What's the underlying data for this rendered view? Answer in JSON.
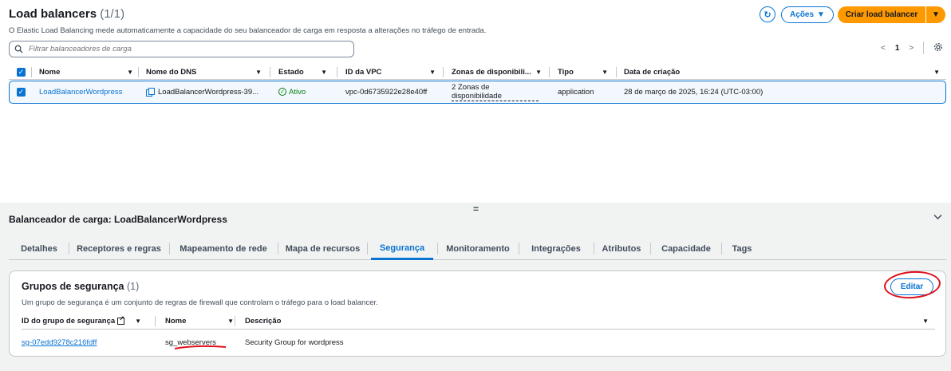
{
  "header": {
    "title": "Load balancers",
    "count": "(1/1)",
    "subtitle": "O Elastic Load Balancing mede automaticamente a capacidade do seu balanceador de carga em resposta a alterações no tráfego de entrada.",
    "actions_label": "Ações",
    "create_label": "Criar load balancer"
  },
  "search": {
    "placeholder": "Filtrar balanceadores de carga"
  },
  "pagination": {
    "page": "1"
  },
  "table": {
    "columns": [
      "Nome",
      "Nome do DNS",
      "Estado",
      "ID da VPC",
      "Zonas de disponibili...",
      "Tipo",
      "Data de criação"
    ],
    "rows": [
      {
        "name": "LoadBalancerWordpress",
        "dns": "LoadBalancerWordpress-39...",
        "state": "Ativo",
        "vpc": "vpc-0d6735922e28e40ff",
        "zones_line1": "2 Zonas de",
        "zones_line2": "disponibilidade",
        "type": "application",
        "created": "28 de março de 2025, 16:24 (UTC-03:00)"
      }
    ]
  },
  "detail": {
    "title": "Balanceador de carga: LoadBalancerWordpress",
    "tabs": [
      "Detalhes",
      "Receptores e regras",
      "Mapeamento de rede",
      "Mapa de recursos",
      "Segurança",
      "Monitoramento",
      "Integrações",
      "Atributos",
      "Capacidade",
      "Tags"
    ],
    "active_tab": "Segurança"
  },
  "security_groups": {
    "title": "Grupos de segurança",
    "count": "(1)",
    "description": "Um grupo de segurança é um conjunto de regras de firewall que controlam o tráfego para o load balancer.",
    "edit_label": "Editar",
    "columns": [
      "ID do grupo de segurança",
      "Nome",
      "Descrição"
    ],
    "rows": [
      {
        "id": "sg-07edd9278c216fdff",
        "name": "sg_webservers",
        "description": "Security Group for wordpress"
      }
    ]
  },
  "colors": {
    "accent": "#0972d3",
    "primary_button": "#ff9900",
    "success": "#037f0c",
    "annotation": "#e0101a"
  }
}
